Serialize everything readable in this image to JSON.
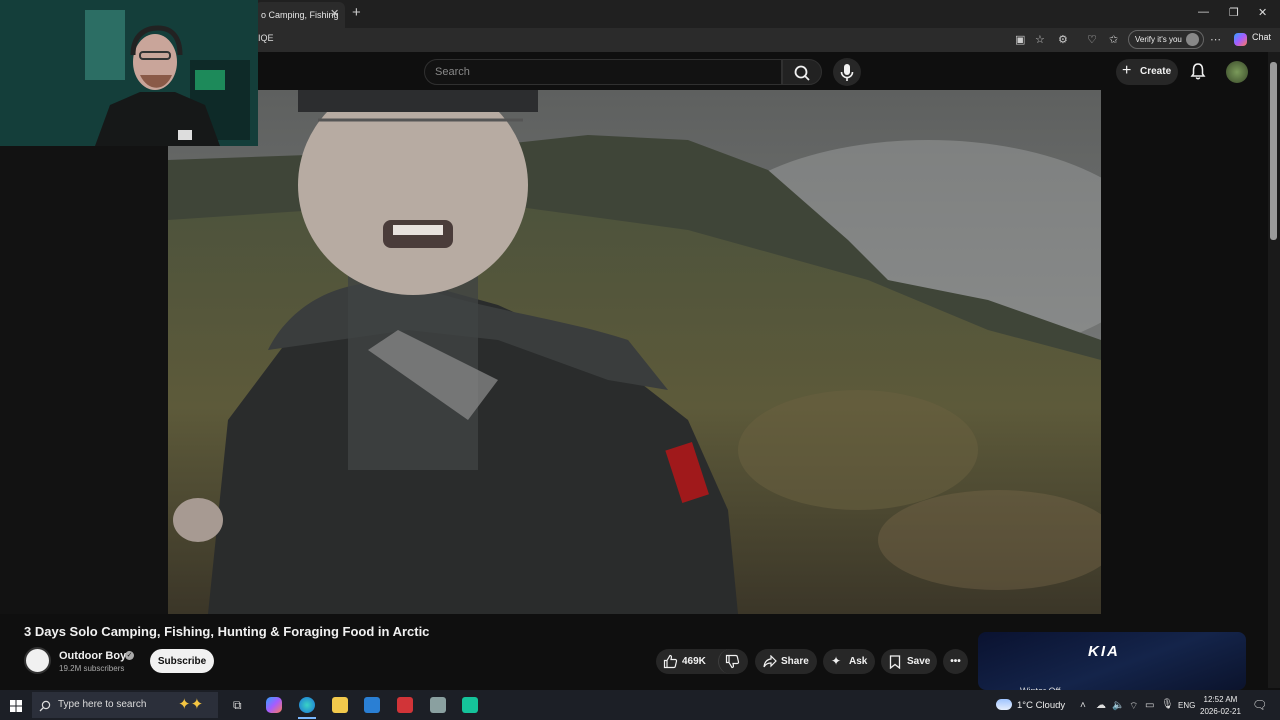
{
  "browser": {
    "tab_title": "o Camping, Fishing",
    "tab_close": "✕",
    "new_tab": "+",
    "url": "IQE",
    "verify_label": "Verify it's you",
    "chat_label": "Chat",
    "window_controls": [
      "—",
      "❐",
      "✕"
    ]
  },
  "header": {
    "search_placeholder": "Search",
    "create_label": "Create"
  },
  "video": {
    "title": "3 Days Solo Camping, Fishing, Hunting & Foraging Food in Arctic"
  },
  "channel": {
    "name": "Outdoor Boys",
    "subscribers": "19.2M subscribers",
    "subscribe_label": "Subscribe"
  },
  "actions": {
    "likes": "469K",
    "share_label": "Share",
    "ask_label": "Ask",
    "save_label": "Save",
    "more_label": "•••"
  },
  "ad": {
    "brand": "KIA",
    "subtitle": "Winter Off..."
  },
  "taskbar": {
    "search_placeholder": "Type here to search",
    "weather": "1°C  Cloudy",
    "language": "ENG",
    "time": "12:52 AM",
    "date": "2026-02-21"
  },
  "colors": {
    "page_bg": "#0f0f0f",
    "pill_bg": "#272727",
    "subscribe_bg": "#f1f1f1",
    "taskbar_bg": "#1c1f26"
  }
}
